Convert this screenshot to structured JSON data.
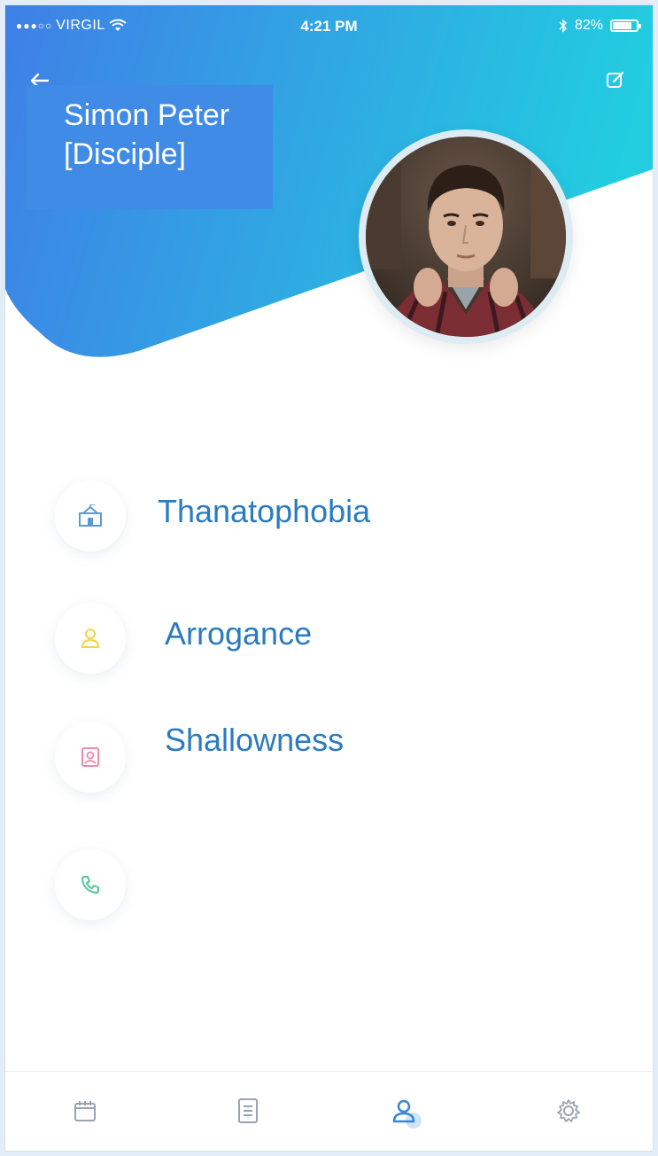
{
  "status_bar": {
    "signal": "●●●○○",
    "carrier": "VIRGIL",
    "time": "4:21 PM",
    "battery": "82%",
    "battery_level": 0.82
  },
  "header": {
    "name_line1": "Simon Peter",
    "name_line2": "[Disciple]",
    "gradient_start": "#3f7fe6",
    "gradient_end": "#22cde0"
  },
  "profile": {
    "avatar_icon": "profile-photo"
  },
  "rows": [
    {
      "icon": "school-icon",
      "label": "Thanatophobia",
      "color": "#5b9bd5"
    },
    {
      "icon": "person-icon",
      "label": "Arrogance",
      "color": "#f2d34a"
    },
    {
      "icon": "id-card-icon",
      "label": "Shallowness",
      "color": "#f08aa6"
    },
    {
      "icon": "phone-icon",
      "label": "",
      "color": "#54c79a"
    }
  ],
  "nav": [
    {
      "icon": "calendar-icon",
      "active": false
    },
    {
      "icon": "document-icon",
      "active": false
    },
    {
      "icon": "user-icon",
      "active": true
    },
    {
      "icon": "settings-icon",
      "active": false
    }
  ],
  "colors": {
    "label_text": "#2a7bc0",
    "nav_active": "#3a86d0",
    "nav_inactive": "#9aa3ad"
  }
}
